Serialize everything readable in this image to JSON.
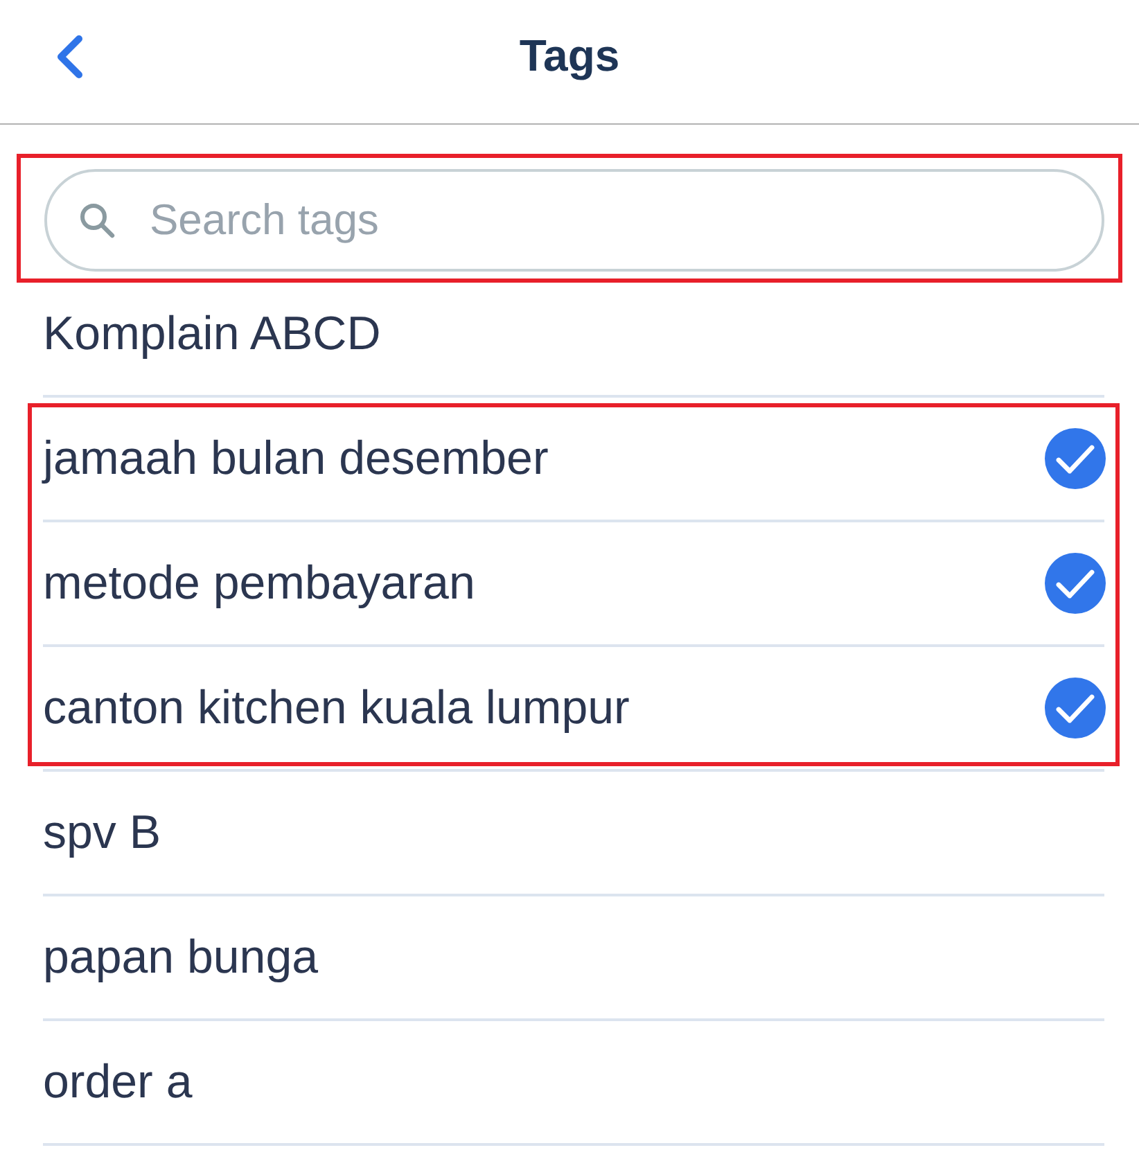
{
  "header": {
    "title": "Tags"
  },
  "search": {
    "placeholder": "Search tags",
    "highlighted": true
  },
  "tag_groups": [
    {
      "highlighted": false,
      "tags": [
        {
          "label": "Komplain ABCD",
          "selected": false
        }
      ]
    },
    {
      "highlighted": true,
      "tags": [
        {
          "label": "jamaah bulan desember",
          "selected": true
        },
        {
          "label": "metode pembayaran",
          "selected": true
        },
        {
          "label": "canton kitchen kuala lumpur",
          "selected": true
        }
      ]
    },
    {
      "highlighted": false,
      "tags": [
        {
          "label": "spv B",
          "selected": false
        },
        {
          "label": "papan bunga",
          "selected": false
        },
        {
          "label": "order a",
          "selected": false
        }
      ]
    }
  ]
}
